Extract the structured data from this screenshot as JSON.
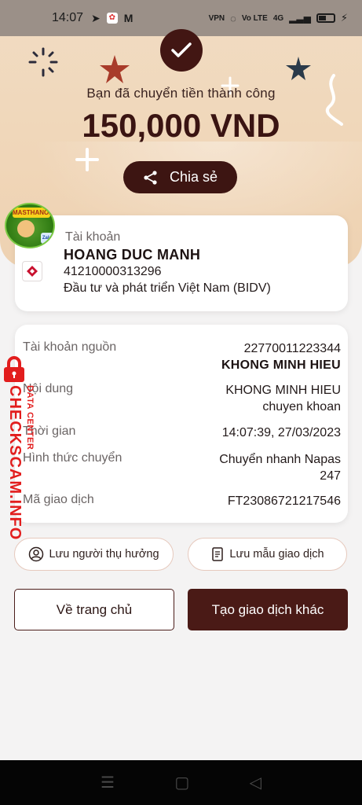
{
  "status_bar": {
    "time": "14:07",
    "icons": [
      "telegram-icon",
      "photos-icon",
      "gmail-icon"
    ],
    "right_labels": [
      "VPN",
      "Vo LTE",
      "4G"
    ]
  },
  "header": {
    "success_message": "Bạn đã chuyển tiền thành công",
    "amount": "150,000 VND",
    "share_label": "Chia sẻ"
  },
  "recipient": {
    "label": "Tài khoản",
    "name": "HOANG DUC MANH",
    "account_number": "41210000313296",
    "bank": "Đầu tư và phát triển Việt Nam (BIDV)",
    "avatar_banner": "MASTHANOD",
    "avatar_badge": "Zalo"
  },
  "details": {
    "source_label": "Tài khoản nguồn",
    "source_account": "22770011223344",
    "source_name": "KHONG MINH HIEU",
    "content_label": "Nội dung",
    "content_line1": "KHONG MINH HIEU",
    "content_line2": "chuyen khoan",
    "time_label": "Thời gian",
    "time_value": "14:07:39, 27/03/2023",
    "method_label": "Hình thức chuyển",
    "method_line1": "Chuyển nhanh Napas",
    "method_line2": "247",
    "txn_label": "Mã giao dịch",
    "txn_value": "FT23086721217546"
  },
  "actions": {
    "save_beneficiary": "Lưu người thụ hưởng",
    "save_template": "Lưu mẫu giao dịch",
    "home": "Về trang chủ",
    "new_transaction": "Tạo giao dịch khác"
  },
  "watermark": {
    "main": "CHECKSCAM.INFO",
    "sub": "DATA CENTER"
  },
  "colors": {
    "brand_dark": "#421613",
    "hero_bg": "#f0d6b8",
    "watermark_red": "#e21d1d"
  }
}
